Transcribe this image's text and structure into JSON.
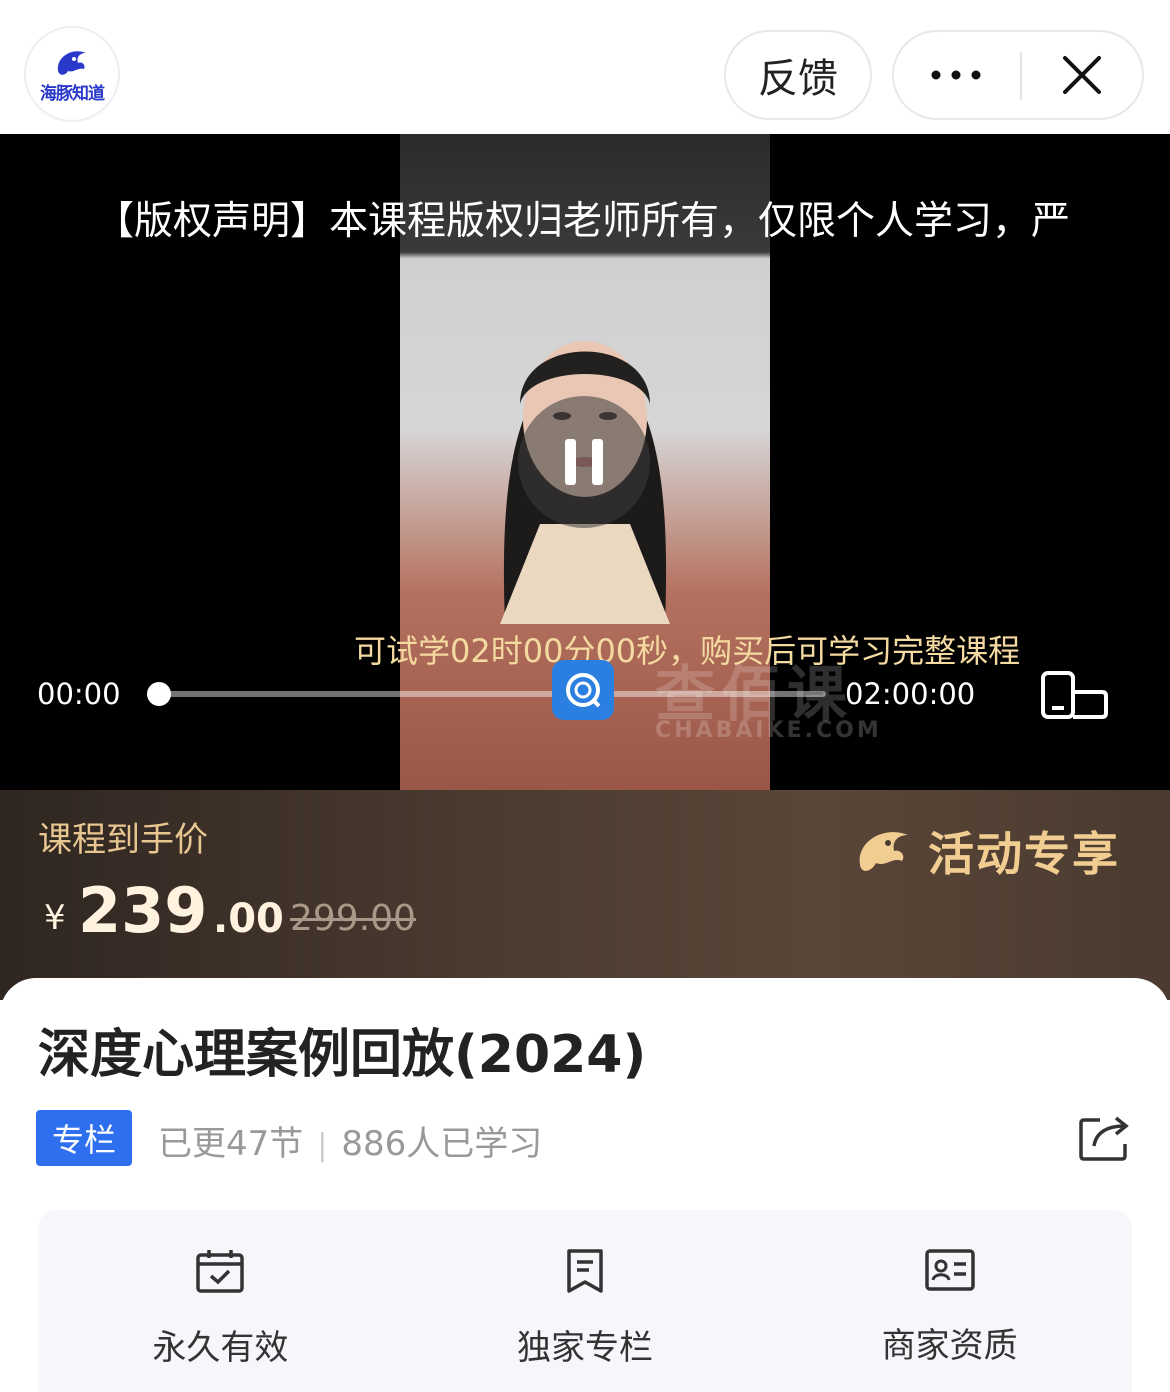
{
  "header": {
    "logo_text": "海豚知道",
    "feedback_label": "反馈",
    "more_icon": "more-dots-icon",
    "close_icon": "close-icon"
  },
  "video": {
    "copyright_notice": "【版权声明】本课程版权归老师所有，仅限个人学习，严",
    "trial_notice": "可试学02时00分00秒，购买后可学习完整课程",
    "current_time": "00:00",
    "total_time": "02:00:00",
    "progress": 0,
    "watermark_text": "查佰课",
    "watermark_sub": "CHABAIKE.COM"
  },
  "price": {
    "label": "课程到手价",
    "currency": "¥",
    "amount_int": "239",
    "amount_dec": ".00",
    "original": "299.00",
    "promo_label": "活动专享"
  },
  "course": {
    "title": "深度心理案例回放(2024)",
    "tag": "专栏",
    "updated": "已更47节",
    "learners": "886人已学习"
  },
  "features": [
    {
      "label": "永久有效",
      "icon": "calendar-check-icon"
    },
    {
      "label": "独家专栏",
      "icon": "bookmark-doc-icon"
    },
    {
      "label": "商家资质",
      "icon": "id-card-icon"
    }
  ],
  "colors": {
    "accent_blue": "#2e6ff0",
    "gold": "#e8c690",
    "banner_dark": "#3a2f28"
  }
}
